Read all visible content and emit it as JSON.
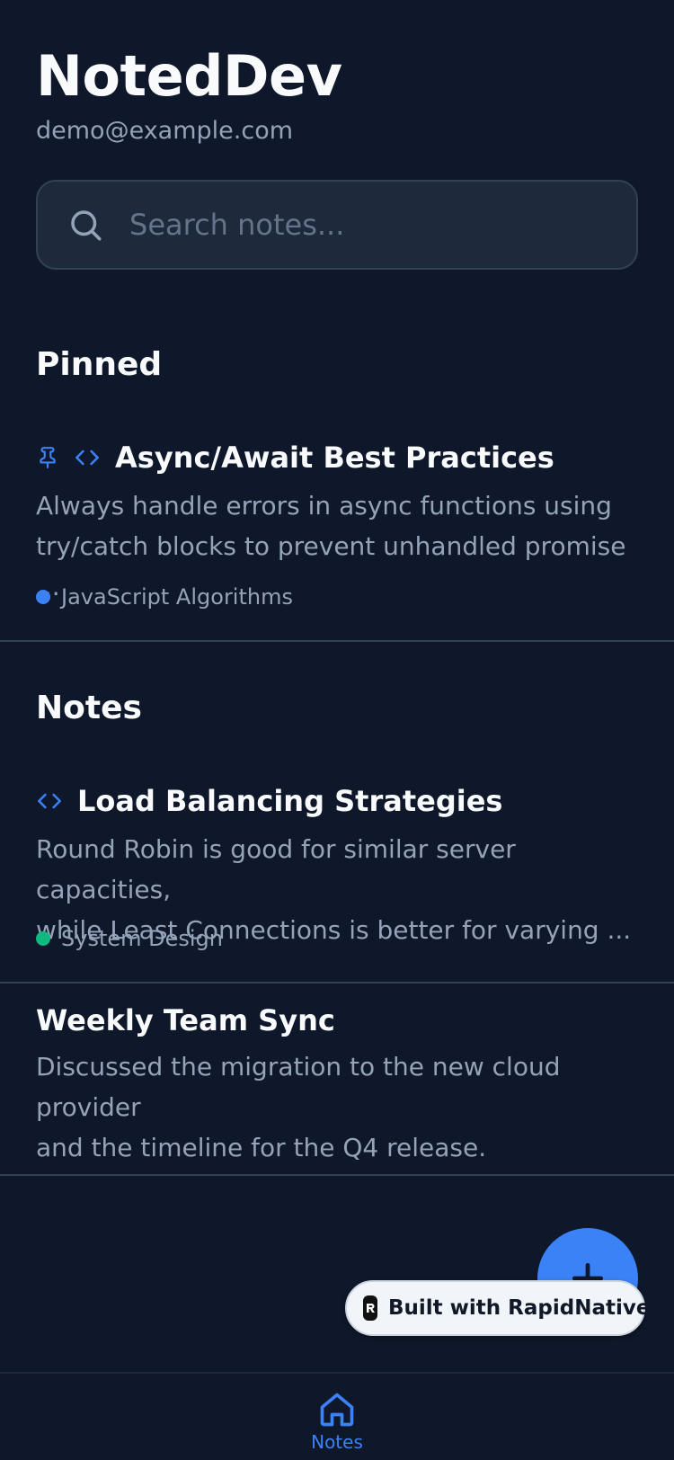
{
  "app": {
    "title": "NotedDev",
    "email": "demo@example.com"
  },
  "search": {
    "placeholder": "Search notes..."
  },
  "sections": {
    "pinned": "Pinned",
    "notes": "Notes"
  },
  "pinned_notes": [
    {
      "title": "Async/Await Best Practices",
      "preview_line1": "Always handle errors in async functions using",
      "preview_line2": "try/catch blocks to prevent unhandled promise ...",
      "tag": "JavaScript Algorithms",
      "tag_color": "#3b82f6",
      "icons": [
        "pin-icon",
        "code-icon"
      ]
    }
  ],
  "notes": [
    {
      "title": "Load Balancing Strategies",
      "preview_line1": "Round Robin is good for similar server capacities,",
      "preview_line2": "while Least Connections is better for varying ...",
      "tag": "System Design",
      "tag_color": "#10b981",
      "icons": [
        "code-icon"
      ]
    },
    {
      "title": "Weekly Team Sync",
      "preview_line1": "Discussed the migration to the new cloud provider",
      "preview_line2": "and the timeline for the Q4 release."
    }
  ],
  "fab": {
    "icon": "plus-icon"
  },
  "badge": {
    "text": "Built with RapidNative"
  },
  "tabbar": {
    "home_label": "Notes",
    "icon": "home-icon"
  },
  "colors": {
    "background": "#0f172a",
    "accent": "#3b82f6",
    "card": "#1e293b",
    "muted": "#94a3b8"
  }
}
